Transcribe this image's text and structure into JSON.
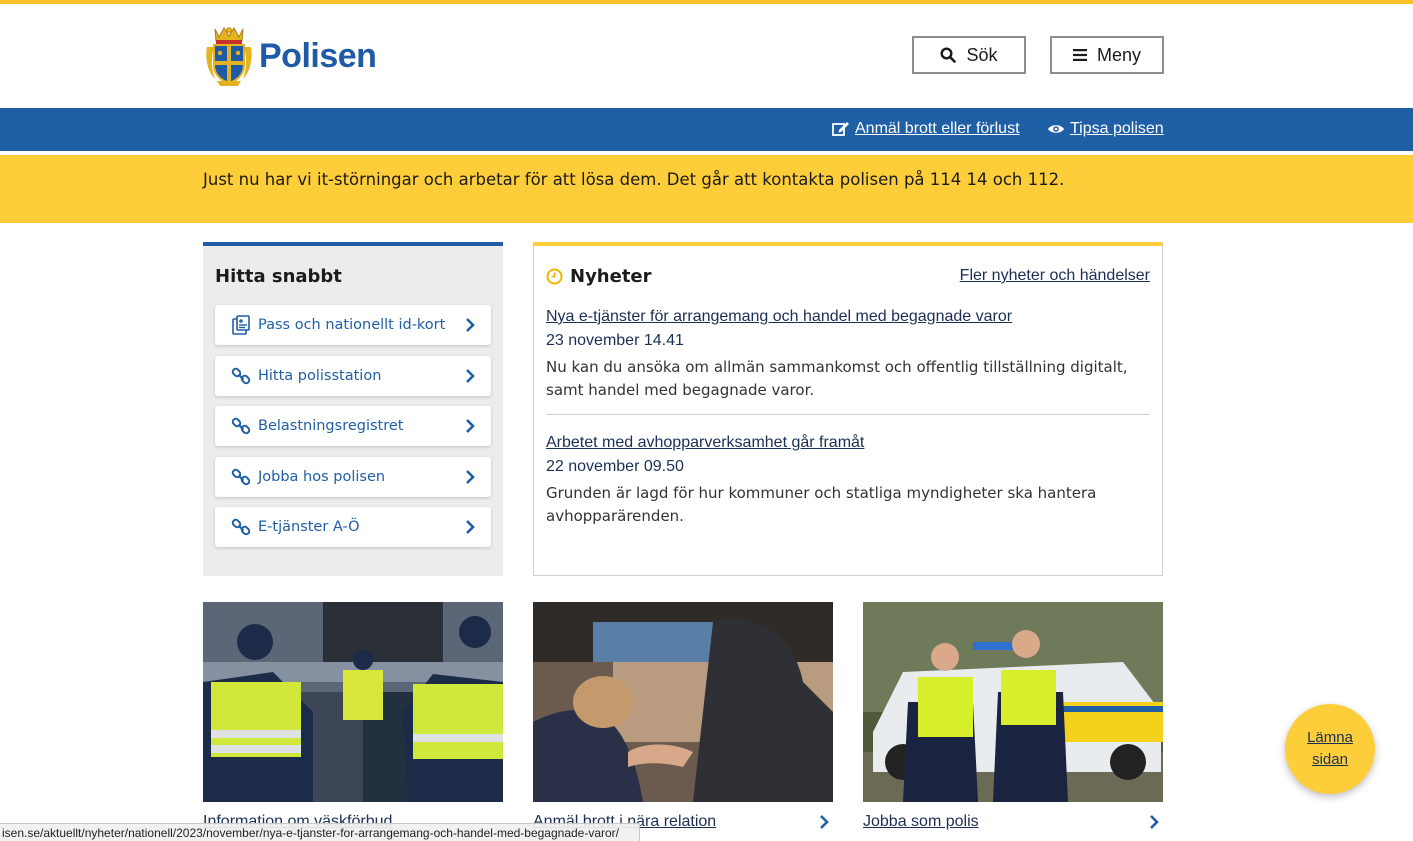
{
  "brand": {
    "name": "Polisen"
  },
  "header": {
    "search_label": "Sök",
    "menu_label": "Meny"
  },
  "topbar": {
    "report_link": "Anmäl brott eller förlust",
    "tip_link": "Tipsa polisen"
  },
  "alert": {
    "text": "Just nu har vi it-störningar och arbetar för att lösa dem. Det går att kontakta polisen på 114 14 och 112."
  },
  "quick": {
    "title": "Hitta snabbt",
    "items": [
      {
        "label": "Pass och nationellt id-kort",
        "icon": "id-card-icon"
      },
      {
        "label": "Hitta polisstation",
        "icon": "link-icon"
      },
      {
        "label": "Belastningsregistret",
        "icon": "link-icon"
      },
      {
        "label": "Jobba hos polisen",
        "icon": "link-icon"
      },
      {
        "label": "E-tjänster A-Ö",
        "icon": "link-icon"
      }
    ]
  },
  "news": {
    "title": "Nyheter",
    "more_link": "Fler nyheter och händelser",
    "articles": [
      {
        "title": "Nya e-tjänster för arrangemang och handel med begagnade varor",
        "date": "23 november 14.41",
        "desc": "Nu kan du ansöka om allmän sammankomst och offentlig tillställning digitalt, samt handel med begagnade varor."
      },
      {
        "title": "Arbetet med avhopparverksamhet går framåt",
        "date": "22 november 09.50",
        "desc": "Grunden är lagd för hur kommuner och statliga myndigheter ska hantera avhopparärenden."
      }
    ]
  },
  "cards": [
    {
      "label": "Information om väskförbud"
    },
    {
      "label": "Anmäl brott i nära relation"
    },
    {
      "label": "Jobba som polis"
    }
  ],
  "leave_button": {
    "line1": "Lämna",
    "line2": "sidan"
  },
  "status_bar": {
    "url": "isen.se/aktuellt/nyheter/nationell/2023/november/nya-e-tjanster-for-arrangemang-och-handel-med-begagnade-varor/"
  },
  "colors": {
    "brand_blue": "#1f5fa6",
    "yellow": "#fecd3a",
    "link_dark": "#1b2f55"
  }
}
